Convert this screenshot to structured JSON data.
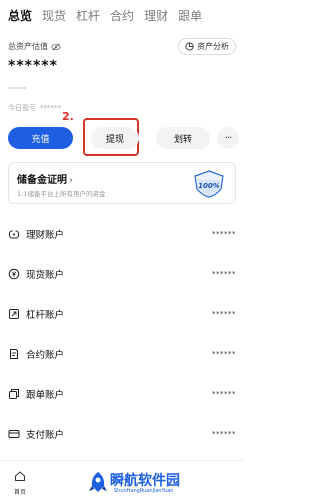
{
  "tabs": [
    {
      "label": "总览"
    },
    {
      "label": "现货"
    },
    {
      "label": "杠杆"
    },
    {
      "label": "合约"
    },
    {
      "label": "理财"
    },
    {
      "label": "跟单"
    }
  ],
  "overview": {
    "total_label": "总资产估值",
    "analysis_label": "资产分析",
    "total_masked": "******",
    "sub_masked": "******",
    "pnl_label": "今日盈亏",
    "pnl_masked": "******"
  },
  "actions": {
    "deposit": "充值",
    "withdraw": "提现",
    "transfer": "划转",
    "more": "···",
    "step_marker": "2."
  },
  "reserve": {
    "title": "储备金证明",
    "arrow": "›",
    "subtitle": "1:1储备平台上所有用户的资金",
    "badge_text": "100%"
  },
  "accounts": [
    {
      "label": "理财账户",
      "value": "******",
      "icon": "piggy-icon"
    },
    {
      "label": "现货账户",
      "value": "******",
      "icon": "coin-icon"
    },
    {
      "label": "杠杆账户",
      "value": "******",
      "icon": "lever-icon"
    },
    {
      "label": "合约账户",
      "value": "******",
      "icon": "contract-icon"
    },
    {
      "label": "跟单账户",
      "value": "******",
      "icon": "copy-icon"
    },
    {
      "label": "支付账户",
      "value": "******",
      "icon": "card-icon"
    }
  ],
  "bottom": {
    "home_label": "首页"
  },
  "watermark": {
    "title": "瞬航软件园",
    "subtitle": "ShunHangRuanJianYuan"
  },
  "colors": {
    "accent": "#1d5fe0",
    "highlight": "#d9342b"
  }
}
